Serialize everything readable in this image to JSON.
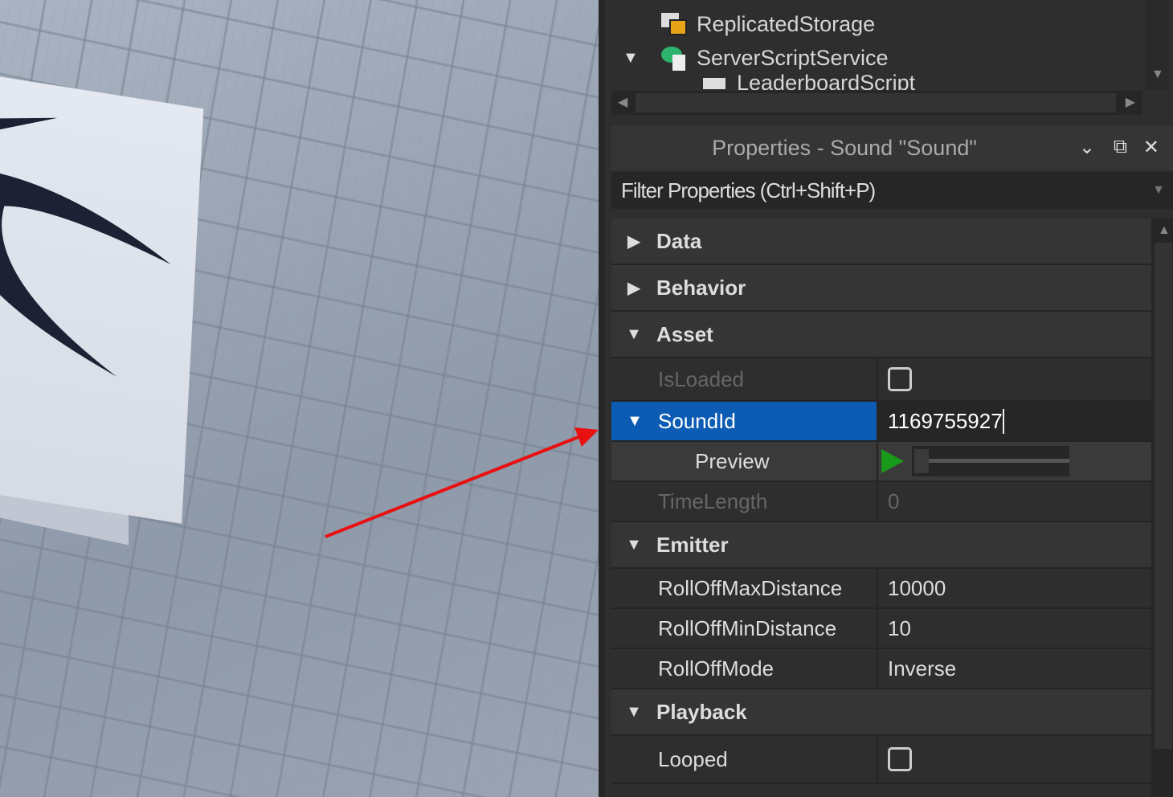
{
  "explorer": {
    "items": [
      {
        "label": "ReplicatedStorage",
        "icon": "replicated-storage-icon"
      },
      {
        "label": "ServerScriptService",
        "icon": "server-script-service-icon",
        "expanded": true
      },
      {
        "label": "LeaderboardScript",
        "icon": "script-icon"
      }
    ]
  },
  "properties": {
    "title": "Properties - Sound \"Sound\"",
    "filter_placeholder": "Filter Properties (Ctrl+Shift+P)",
    "categories": {
      "data": "Data",
      "behavior": "Behavior",
      "asset": "Asset",
      "emitter": "Emitter",
      "playback": "Playback"
    },
    "rows": {
      "isloaded": {
        "name": "IsLoaded",
        "checked": false
      },
      "soundid": {
        "name": "SoundId",
        "value": "1169755927"
      },
      "preview": {
        "name": "Preview",
        "progress": 0
      },
      "timelength": {
        "name": "TimeLength",
        "value": "0"
      },
      "rolloffmax": {
        "name": "RollOffMaxDistance",
        "value": "10000"
      },
      "rolloffmin": {
        "name": "RollOffMinDistance",
        "value": "10"
      },
      "rolloffmode": {
        "name": "RollOffMode",
        "value": "Inverse"
      },
      "looped": {
        "name": "Looped",
        "checked": false
      }
    }
  },
  "colors": {
    "selection": "#0c5cb4",
    "annotation_arrow": "#e81010",
    "play": "#1a9a1a"
  }
}
